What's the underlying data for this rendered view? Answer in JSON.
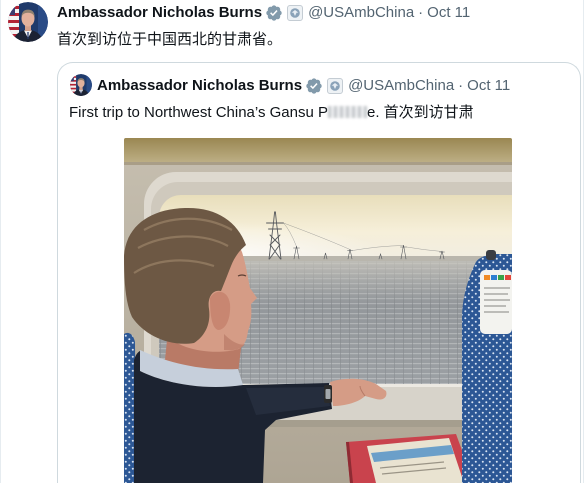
{
  "tweet": {
    "author": {
      "name": "Ambassador Nicholas Burns",
      "handle": "@USAmbChina",
      "separator": "·",
      "date": "Oct 11"
    },
    "text": "首次到访位于中国西北的甘肃省。",
    "quoted": {
      "author": {
        "name": "Ambassador Nicholas Burns",
        "handle": "@USAmbChina",
        "separator": "·",
        "date": "Oct 11"
      },
      "text_before_obscured": "First trip to Northwest China’s Gansu P",
      "text_after_obscured": "e. 首次到访甘肃"
    }
  },
  "icons": {
    "avatar": "author-avatar",
    "verified": "verified-badge-icon",
    "affiliation": "affiliation-badge-icon"
  },
  "colors": {
    "text_primary": "#0f1419",
    "text_secondary": "#536471",
    "verified_badge": "#829aab",
    "border": "#cfd9de",
    "background": "#ffffff"
  }
}
